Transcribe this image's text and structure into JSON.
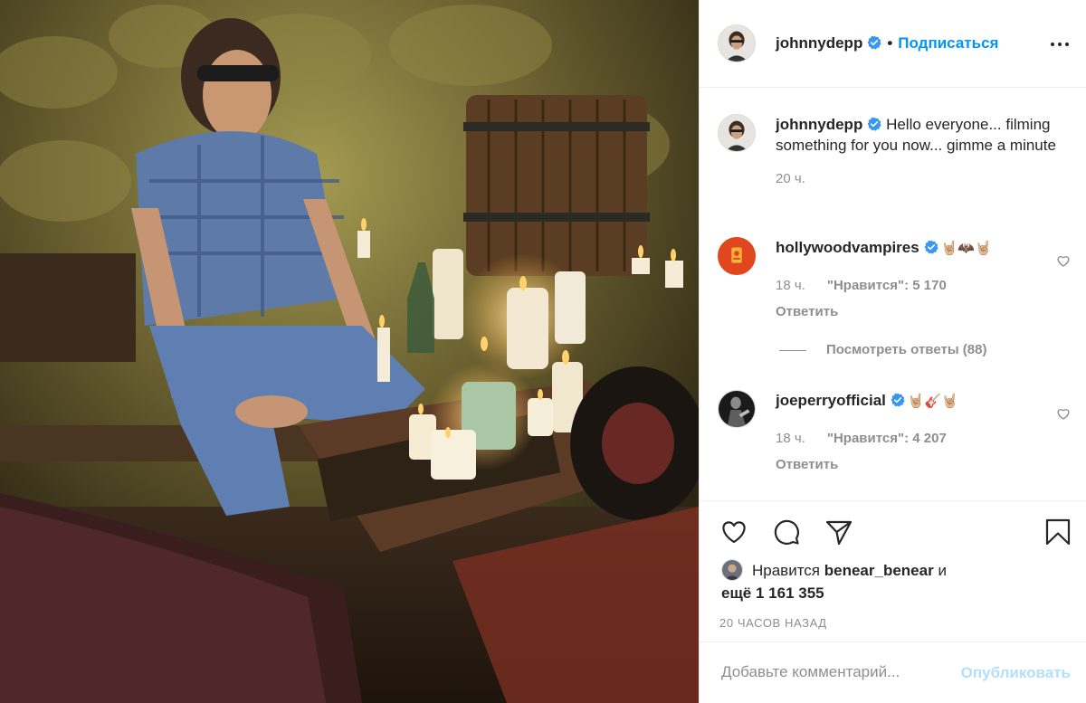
{
  "post": {
    "image_alt": "Man seated at a candle-lit table in a stone cellar",
    "author": "johnnydepp",
    "separator": "•",
    "follow_label": "Подписаться",
    "more_icon": "more-horizontal-icon"
  },
  "caption": {
    "username": "johnnydepp",
    "text": "Hello everyone... filming something for you now... gimme a minute",
    "time": "20 ч."
  },
  "comments": [
    {
      "username": "hollywoodvampires",
      "emoji": "🤘🏼🦇🤘🏼",
      "time": "18 ч.",
      "likes": "\"Нравится\": 5 170",
      "reply_label": "Ответить"
    },
    {
      "username": "joeperryofficial",
      "emoji": "🤘🏼🎸🤘🏼",
      "time": "18 ч.",
      "likes": "\"Нравится\": 4 207",
      "reply_label": "Ответить"
    }
  ],
  "view_replies": "Посмотреть ответы (88)",
  "actions": {
    "like_icon": "heart-icon",
    "comment_icon": "comment-icon",
    "share_icon": "share-icon",
    "save_icon": "bookmark-icon"
  },
  "liked_by": {
    "prefix": "Нравится",
    "user": "benear_benear",
    "conj": "и",
    "rest": "ещё 1 161 355"
  },
  "posted_ago": "20 ЧАСОВ НАЗАД",
  "add_comment": {
    "placeholder": "Добавьте комментарий...",
    "publish_label": "Опубликовать"
  },
  "colors": {
    "accent": "#0095f6",
    "publish_disabled": "#b2dffc",
    "secondary_text": "#8e8e8e",
    "divider": "#efefef"
  }
}
